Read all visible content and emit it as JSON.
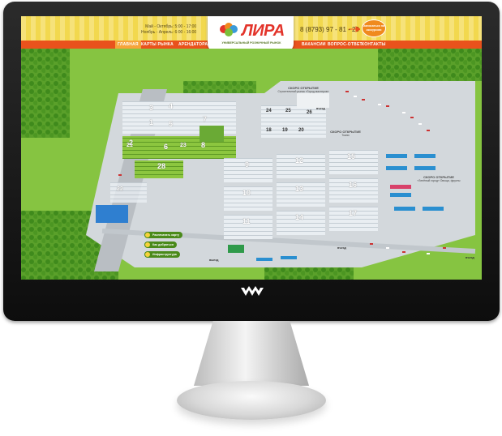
{
  "site": {
    "hours": [
      "Май - Октябрь: 5:00 - 17:00",
      "Ноябрь - Апрель: 6:00 - 16:00"
    ],
    "logo": "ЛИРА",
    "logo_subtitle": "УНИВЕРСАЛЬНЫЙ РОЗНИЧНЫЙ РЫНОК",
    "phone": "8 (8793) 97 - 81 - 29",
    "badge": "Записаться на экскурсию",
    "nav": [
      {
        "label": "ГЛАВНАЯ"
      },
      {
        "label": "КАРТЫ РЫНКА"
      },
      {
        "label": "АРЕНДАТОРАМ"
      },
      {
        "label": "ВАКАНСИИ"
      },
      {
        "label": "ВОПРОС-ОТВЕТ"
      },
      {
        "label": "КОНТАКТЫ"
      }
    ]
  },
  "map": {
    "buildings_left": [
      "1",
      "2",
      "3",
      "4",
      "5",
      "6",
      "7",
      "8",
      "21",
      "22",
      "23",
      "28"
    ],
    "buildings_center": [
      "9",
      "10",
      "11",
      "12",
      "13",
      "14",
      "15",
      "16",
      "17"
    ],
    "buildings_top": [
      "18",
      "19",
      "20",
      "24",
      "25",
      "26"
    ],
    "soon_1": "СКОРО ОТКРЫТИЕ",
    "soon_1_sub": "Строительный рынок «Город мастеров»",
    "soon_2": "СКОРО ОТКРЫТИЕ",
    "soon_2_sub": "Ткани",
    "soon_3": "СКОРО ОТКРЫТИЕ",
    "soon_3_sub": "«Зелёный город» Овощи, фрукты",
    "entry": "въезд",
    "entry_2": "въезд",
    "entry_3": "въезд",
    "exit": "выезд",
    "links": [
      "Распечатать карту",
      "Как добраться",
      "Инфраструктура"
    ]
  },
  "colors": {
    "nav": "#e9521c",
    "header": "#f2d84e",
    "logo": "#e3342b",
    "grass": "#7bbf3a"
  }
}
